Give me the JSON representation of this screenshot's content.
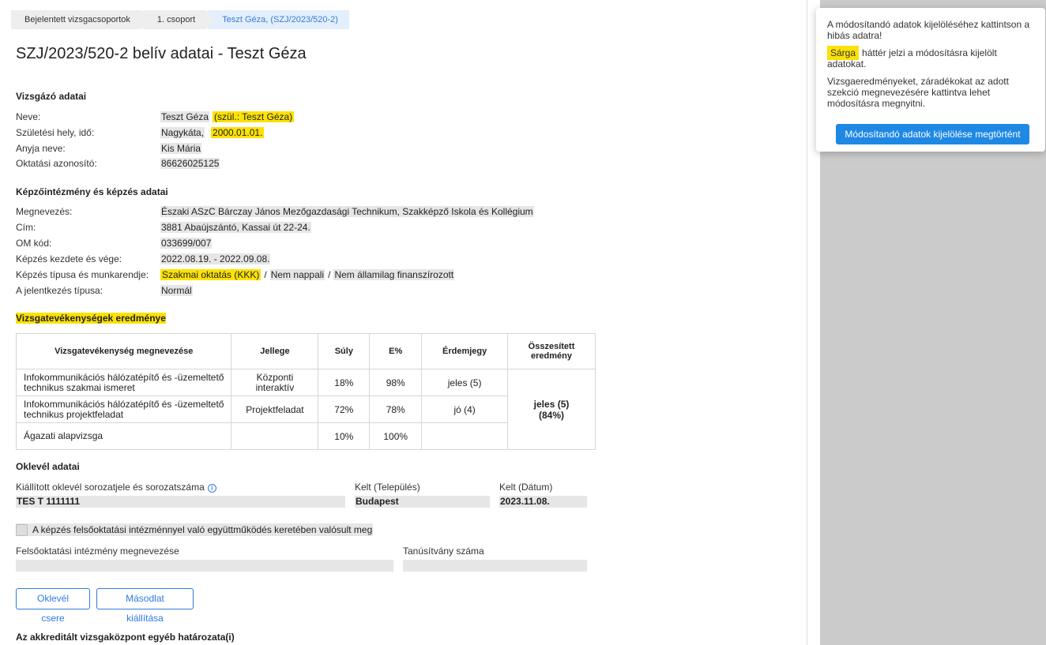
{
  "breadcrumb": [
    "Bejelentett vizsgacsoportok",
    "1. csoport",
    "Teszt Géza, (SZJ/2023/520-2)"
  ],
  "page_title": "SZJ/2023/520-2 belív adatai - Teszt Géza",
  "exam_taker": {
    "section_title": "Vizsgázó adatai",
    "name_label": "Neve:",
    "name": "Teszt Géza",
    "birth_name": "(szül.: Teszt Géza)",
    "birth_label": "Születési hely, idő:",
    "birth_place": "Nagykáta,",
    "birth_date": "2000.01.01.",
    "mother_label": "Anyja neve:",
    "mother": "Kis Mária",
    "edu_id_label": "Oktatási azonosító:",
    "edu_id": "86626025125"
  },
  "institution": {
    "section_title": "Képzőintézmény és képzés adatai",
    "name_label": "Megnevezés:",
    "name": "Északi ASzC Bárczay János Mezőgazdasági Technikum, Szakképző Iskola és Kollégium",
    "address_label": "Cím:",
    "address": "3881 Abaújszántó, Kassai út 22-24.",
    "om_label": "OM kód:",
    "om": "033699/007",
    "period_label": "Képzés kezdete és vége:",
    "period": "2022.08.19. - 2022.09.08.",
    "type_label": "Képzés típusa és munkarendje:",
    "type1": "Szakmai oktatás (KKK)",
    "type2": "Nem nappali",
    "type3": "Nem államilag finanszírozott",
    "type_sep": "/",
    "application_label": "A jelentkezés típusa:",
    "application": "Normál"
  },
  "results": {
    "section_title": "Vizsgatevékenységek eredménye",
    "headers": [
      "Vizsgatevékenység megnevezése",
      "Jellege",
      "Súly",
      "E%",
      "Érdemjegy",
      "Összesített eredmény"
    ],
    "rows": [
      {
        "name": "Infokommunikációs hálózatépítő és -üzemeltető technikus szakmai ismeret",
        "type": "Központi interaktív",
        "weight": "18%",
        "percent": "98%",
        "grade": "jeles (5)"
      },
      {
        "name": "Infokommunikációs hálózatépítő és -üzemeltető technikus projektfeladat",
        "type": "Projektfeladat",
        "weight": "72%",
        "percent": "78%",
        "grade": "jó (4)"
      },
      {
        "name": "Ágazati alapvizsga",
        "type": "",
        "weight": "10%",
        "percent": "100%",
        "grade": ""
      }
    ],
    "summary_grade": "jeles (5)",
    "summary_percent": "(84%)"
  },
  "diploma": {
    "section_title": "Oklevél adatai",
    "serial_label": "Kiállított oklevél sorozatjele és sorozatszáma",
    "serial": "TES T 1111111",
    "place_label": "Kelt (Település)",
    "place": "Budapest",
    "date_label": "Kelt (Dátum)",
    "date": "2023.11.08.",
    "checkbox_label": "A képzés felsőoktatási intézménnyel való együttműködés keretében valósult meg",
    "higher_ed_label": "Felsőoktatási intézmény megnevezése",
    "higher_ed": "",
    "cert_label": "Tanúsítvány száma",
    "cert": ""
  },
  "buttons": {
    "replace": "Oklevél csere",
    "duplicate": "Másodlat kiállítása"
  },
  "other_section_title": "Az akkreditált vizsgaközpont egyéb határozata(i)",
  "popup": {
    "line1": "A módosítandó adatok kijelöléséhez kattintson a hibás adatra!",
    "yellow_word": "Sárga",
    "line2": "háttér jelzi a módosításra kijelölt adatokat.",
    "line3": "Vizsgaeredményeket, záradékokat az adott szekció megnevezésére kattintva lehet módosításra megnyitni.",
    "button": "Módosítandó adatok kijelölése megtörtént"
  },
  "colors": {
    "highlight": "#fce205",
    "primary": "#1e88e5",
    "field_bg": "#e6e6e6"
  }
}
